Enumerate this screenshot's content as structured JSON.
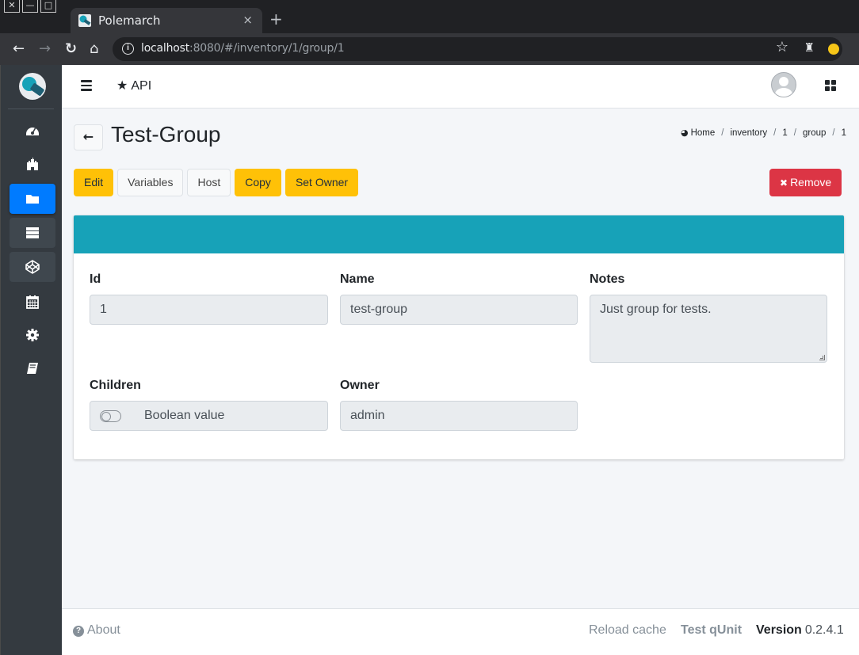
{
  "browser": {
    "tab_title": "Polemarch",
    "tab_close": "×",
    "new_tab": "+",
    "url_host": "localhost",
    "url_rest": ":8080/#/inventory/1/group/1"
  },
  "topnav": {
    "api_label": "API"
  },
  "page": {
    "back_arrow": "🡐",
    "title": "Test-Group"
  },
  "breadcrumb": {
    "items": [
      "Home",
      "inventory",
      "1",
      "group",
      "1"
    ],
    "separator": "/"
  },
  "actions": {
    "edit": "Edit",
    "variables": "Variables",
    "host": "Host",
    "copy": "Copy",
    "set_owner": "Set Owner",
    "remove": "Remove"
  },
  "form": {
    "id": {
      "label": "Id",
      "value": "1"
    },
    "name": {
      "label": "Name",
      "value": "test-group"
    },
    "notes": {
      "label": "Notes",
      "value": "Just group for tests."
    },
    "children": {
      "label": "Children",
      "value": "Boolean value",
      "checked": false
    },
    "owner": {
      "label": "Owner",
      "value": "admin"
    }
  },
  "footer": {
    "about": "About",
    "reload_cache": "Reload cache",
    "test_qunit": "Test qUnit",
    "version_label": "Version",
    "version_number": "0.2.4.1"
  },
  "sidebar": {
    "items": [
      {
        "icon": "dashboard-icon",
        "active": false
      },
      {
        "icon": "castle-icon",
        "active": false
      },
      {
        "icon": "folder-icon",
        "active": true
      },
      {
        "icon": "server-icon",
        "active": false
      },
      {
        "icon": "codepen-icon",
        "active": false
      },
      {
        "icon": "calendar-icon",
        "active": false
      },
      {
        "icon": "gear-icon",
        "active": false
      },
      {
        "icon": "book-icon",
        "active": false
      }
    ]
  },
  "colors": {
    "accent": "#17a2b8",
    "active_nav": "#007bff",
    "warning": "#ffc107",
    "danger": "#dc3545",
    "sidebar_bg": "#343a40"
  }
}
